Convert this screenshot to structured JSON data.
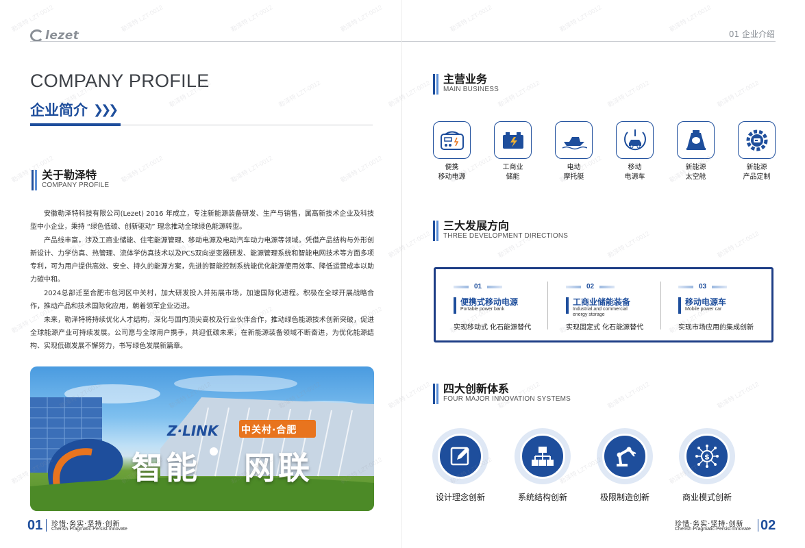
{
  "header": {
    "logo_text": "lezet",
    "section_tag": "01 企业介绍"
  },
  "left": {
    "title_en": "COMPANY PROFILE",
    "title_cn": "企业简介",
    "about": {
      "title_cn": "关于勒泽特",
      "title_en": "COMPANY PROFILE"
    },
    "paragraphs": [
      "安徽勒泽特科技有限公司(Lezet) 2016 年成立，专注新能源装备研发、生产与销售，属高新技术企业及科技型中小企业，秉持 “绿色低碳、创新驱动” 理念推动全球绿色能源转型。",
      "产品线丰富，涉及工商业储能、住宅能源管理、移动电源及电动汽车动力电源等领域。凭借产品结构与外形创新设计、力学仿真、热管理、流体学仿真技术以及PCS双向逆变器研发、能源管理系统和智能电网技术等方面多项专利，可为用户提供高效、安全、持久的能源方案，先进的智能控制系统能优化能源使用效率、降低运营成本以助力碳中和。",
      "2024总部迁至合肥市包河区中关村，加大研发投入并拓展市场，加速国际化进程。积极在全球开展战略合作，推动产品和技术国际化应用，朝着领军企业迈进。",
      "未来，勒泽特将持续优化人才结构，深化与国内顶尖高校及行业伙伴合作，推动绿色能源技术创新突破，促进全球能源产业可持续发展。公司愿与全球用户携手，共迎低碳未来，在新能源装备领域不断奋进，为优化能源结构、实现低碳发展不懈努力，书写绿色发展新篇章。"
    ],
    "photo": {
      "sign_text": "中关村·合肥",
      "building_text": "Z·LINK",
      "slogan_left": "智能",
      "slogan_right": "网联"
    },
    "footer": {
      "page_num": "01",
      "motto_cn": "珍惜·务实·坚持·创新",
      "motto_en": "Cherish·Pragmatic·Persist·Innovate"
    }
  },
  "right": {
    "main_business": {
      "title_cn": "主营业务",
      "title_en": "MAIN BUSINESS",
      "items": [
        {
          "line1": "便携",
          "line2": "移动电源",
          "icon": "portable-power-icon"
        },
        {
          "line1": "工商业",
          "line2": "储能",
          "icon": "battery-storage-icon"
        },
        {
          "line1": "电动",
          "line2": "摩托艇",
          "icon": "boat-icon"
        },
        {
          "line1": "移动",
          "line2": "电源车",
          "icon": "ev-car-icon"
        },
        {
          "line1": "新能源",
          "line2": "太空舱",
          "icon": "space-capsule-icon"
        },
        {
          "line1": "新能源",
          "line2": "产品定制",
          "icon": "custom-gear-icon"
        }
      ]
    },
    "directions": {
      "title_cn": "三大发展方向",
      "title_en": "THREE DEVELOPMENT DIRECTIONS",
      "items": [
        {
          "num": "01",
          "title": "便携式移动电源",
          "en": "Portable power bank",
          "desc": "实现移动式 化石能源替代"
        },
        {
          "num": "02",
          "title": "工商业储能装备",
          "en": "Industrial and commercial energy storage",
          "desc": "实现固定式 化石能源替代"
        },
        {
          "num": "03",
          "title": "移动电源车",
          "en": "Mobile power car",
          "desc": "实现市场应用的集成创新"
        }
      ]
    },
    "innovation": {
      "title_cn": "四大创新体系",
      "title_en": "FOUR MAJOR INNOVATION SYSTEMS",
      "items": [
        {
          "label": "设计理念创新",
          "icon": "design-edit-icon"
        },
        {
          "label": "系统结构创新",
          "icon": "structure-tree-icon"
        },
        {
          "label": "极限制造创新",
          "icon": "robot-arm-icon"
        },
        {
          "label": "商业模式创新",
          "icon": "dollar-network-icon"
        }
      ]
    },
    "footer": {
      "page_num": "02",
      "motto_cn": "珍惜·务实·坚持·创新",
      "motto_en": "Cherish·Pragmatic·Persist·Innovate"
    }
  },
  "watermark_text": "勒泽特 LZT-0012",
  "colors": {
    "brand_blue": "#1e4e9c",
    "dark_navy": "#1e3e86",
    "gray": "#8a8f96"
  }
}
